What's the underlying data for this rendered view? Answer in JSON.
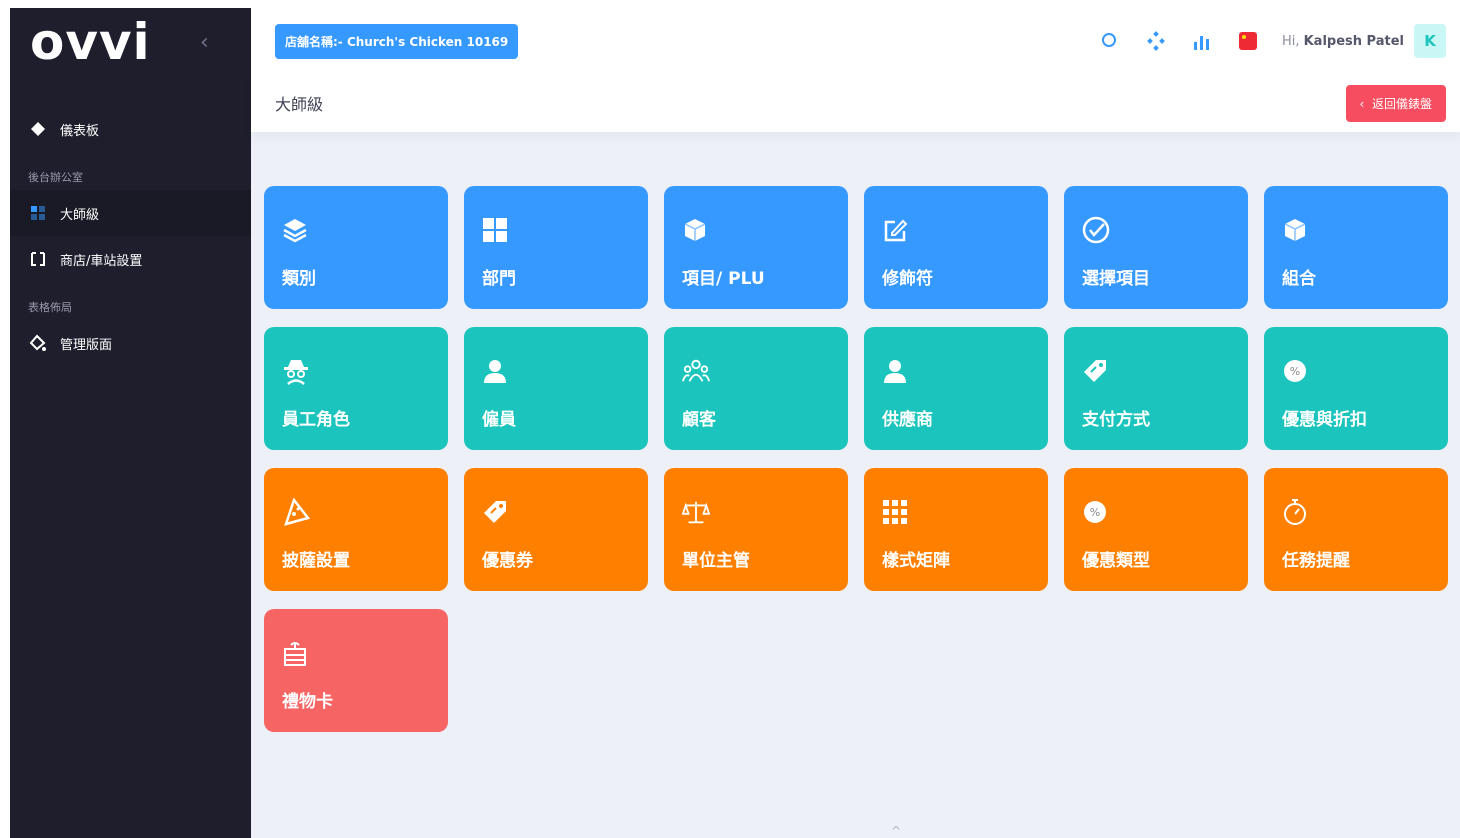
{
  "sidebar": {
    "logo": "ovvi",
    "collapse_icon": "chevron-left-icon",
    "items": [
      {
        "type": "item",
        "label": "儀表板",
        "icon": "diamond-icon",
        "active": false
      },
      {
        "type": "section",
        "label": "後台辦公室"
      },
      {
        "type": "item",
        "label": "大師級",
        "icon": "grid-icon",
        "active": true
      },
      {
        "type": "item",
        "label": "商店/車站設置",
        "icon": "store-icon",
        "active": false
      },
      {
        "type": "section",
        "label": "表格佈局"
      },
      {
        "type": "item",
        "label": "管理版面",
        "icon": "fill-icon",
        "active": false
      }
    ]
  },
  "topbar": {
    "store_label": "店舖名稱:- Church's Chicken 10169",
    "greeting_prefix": "Hi,",
    "user_name": "Kalpesh Patel",
    "avatar_letter": "K",
    "icons": [
      "search-icon",
      "connections-icon",
      "chart-icon",
      "flag-icon"
    ]
  },
  "subheader": {
    "title": "大師級",
    "back_label": "返回儀錶盤"
  },
  "tiles": [
    {
      "label": "類別",
      "icon": "layers-icon",
      "color": "blue"
    },
    {
      "label": "部門",
      "icon": "grid-icon",
      "color": "blue"
    },
    {
      "label": "項目/ PLU",
      "icon": "box-icon",
      "color": "blue"
    },
    {
      "label": "修飾符",
      "icon": "edit-icon",
      "color": "blue"
    },
    {
      "label": "選擇項目",
      "icon": "check-circle-icon",
      "color": "blue"
    },
    {
      "label": "組合",
      "icon": "box-icon",
      "color": "blue"
    },
    {
      "label": "員工角色",
      "icon": "spy-icon",
      "color": "teal"
    },
    {
      "label": "僱員",
      "icon": "user-icon",
      "color": "teal"
    },
    {
      "label": "顧客",
      "icon": "users-icon",
      "color": "teal"
    },
    {
      "label": "供應商",
      "icon": "user-icon",
      "color": "teal"
    },
    {
      "label": "支付方式",
      "icon": "tag-icon",
      "color": "teal"
    },
    {
      "label": "優惠與折扣",
      "icon": "percent-badge-icon",
      "color": "teal"
    },
    {
      "label": "披薩設置",
      "icon": "pizza-icon",
      "color": "orange"
    },
    {
      "label": "優惠券",
      "icon": "tag-icon",
      "color": "orange"
    },
    {
      "label": "單位主管",
      "icon": "scale-icon",
      "color": "orange"
    },
    {
      "label": "樣式矩陣",
      "icon": "matrix-icon",
      "color": "orange"
    },
    {
      "label": "優惠類型",
      "icon": "percent-badge-icon",
      "color": "orange"
    },
    {
      "label": "任務提醒",
      "icon": "stopwatch-icon",
      "color": "orange"
    },
    {
      "label": "禮物卡",
      "icon": "gift-icon",
      "color": "red"
    }
  ],
  "colors": {
    "blue": "#3699ff",
    "teal": "#1bc5bd",
    "orange": "#ff7f00",
    "red": "#f66464",
    "sidebar": "#1e1e2d"
  }
}
